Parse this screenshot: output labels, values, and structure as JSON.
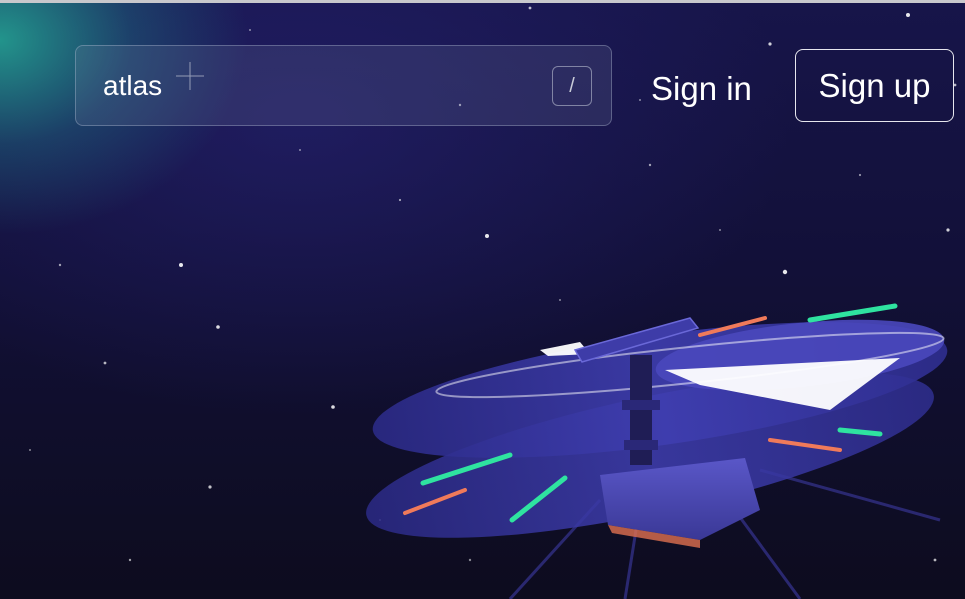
{
  "header": {
    "search": {
      "value": "atlas",
      "shortcut_key": "/"
    },
    "sign_in_label": "Sign in",
    "sign_up_label": "Sign up"
  },
  "colors": {
    "background": "#0d0c1e",
    "glow": "#24aa96",
    "rotor_blue": "#3b3aa0",
    "accent_green": "#2fe3a0",
    "accent_orange": "#f07a5a"
  },
  "illustration": {
    "subject": "helicopter-drone"
  }
}
